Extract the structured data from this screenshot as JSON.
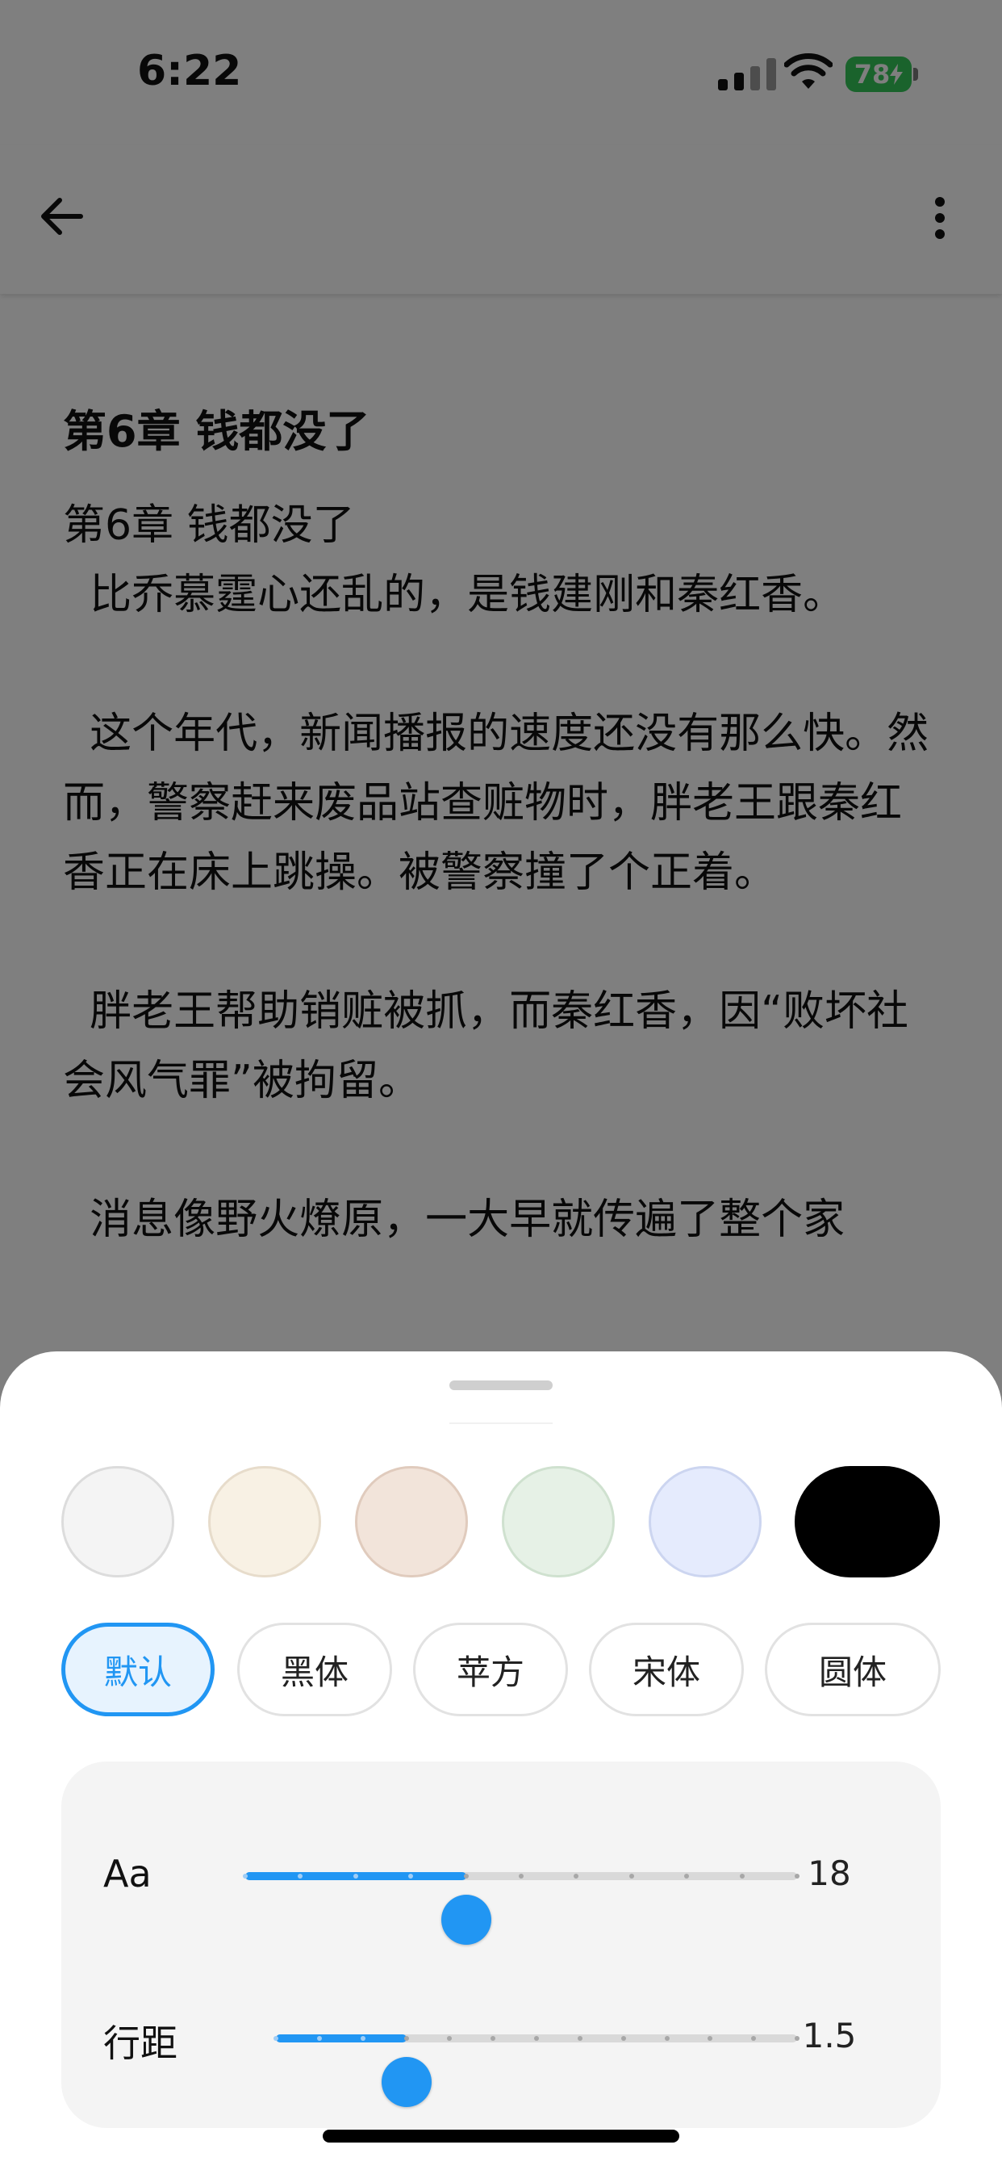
{
  "status_bar": {
    "time": "6:22",
    "battery": "78"
  },
  "app_bar": {
    "back_icon": "arrow-left-icon",
    "more_icon": "more-vert-icon"
  },
  "reader": {
    "chapter_heading": "第6章 钱都没了",
    "body": "第6章 钱都没了\n  比乔慕霆心还乱的，是钱建刚和秦红香。\n\n  这个年代，新闻播报的速度还没有那么快。然而，警察赶来废品站查赃物时，胖老王跟秦红香正在床上跳操。被警察撞了个正着。\n\n  胖老王帮助销赃被抓，而秦红香，因“败坏社会风气罪”被拘留。\n\n  消息像野火燎原，一大早就传遍了整个家"
  },
  "settings": {
    "background_swatches": [
      {
        "name": "white",
        "color": "#f4f4f4",
        "border": "#dcdcdc"
      },
      {
        "name": "cream",
        "color": "#f8f1e4",
        "border": "#e7dccb"
      },
      {
        "name": "peach",
        "color": "#f2e4da",
        "border": "#e0cbbd"
      },
      {
        "name": "mint",
        "color": "#e6f1e6",
        "border": "#cfe1cf"
      },
      {
        "name": "lavender",
        "color": "#e5ebfd",
        "border": "#ccd5f0"
      },
      {
        "name": "black",
        "color": "#000000",
        "border": "#000000"
      }
    ],
    "fonts": [
      "默认",
      "黑体",
      "苹方",
      "宋体",
      "圆体"
    ],
    "selected_font": "默认",
    "font_size": {
      "label": "Aa",
      "value": "18",
      "fraction": 0.4,
      "ticks": 10
    },
    "line_spacing": {
      "label": "行距",
      "value": "1.5",
      "fraction": 0.25,
      "ticks": 12
    }
  },
  "colors": {
    "accent": "#2196f3",
    "overlay": "rgba(0,0,0,0.5)"
  }
}
